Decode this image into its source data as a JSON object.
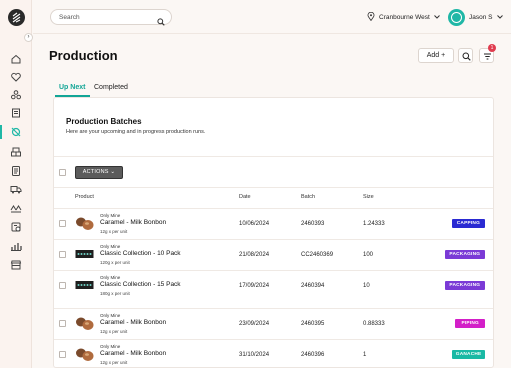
{
  "search": {
    "placeholder": "Search"
  },
  "location": {
    "label": "Cranbourne West"
  },
  "user": {
    "name": "Jason S"
  },
  "header": {
    "title": "Production",
    "add_label": "Add +",
    "notification_count": "1"
  },
  "tabs": [
    {
      "label": "Up Next"
    },
    {
      "label": "Completed"
    }
  ],
  "card": {
    "title": "Production Batches",
    "subtitle": "Here are your upcoming and in progress production runs.",
    "actions_label": "ACTIONS ⌄"
  },
  "table": {
    "columns": {
      "product": "Product",
      "date": "Date",
      "batch": "Batch",
      "size": "Size"
    },
    "rows": [
      {
        "brand": "Only Mine",
        "name": "Caramel - Milk Bonbon",
        "weight": "12g x per unit",
        "date": "10/06/2024",
        "batch": "2460393",
        "size": "1.24333",
        "status": "CAPPING",
        "status_color": "#2a2ad2",
        "thumb": "bonbon"
      },
      {
        "brand": "Only Mine",
        "name": "Classic Collection - 10 Pack",
        "weight": "120g x per unit",
        "date": "21/08/2024",
        "batch": "CC2460369",
        "size": "100",
        "status": "PACKAGING",
        "status_color": "#7b3ad6",
        "thumb": "box"
      },
      {
        "brand": "Only Mine",
        "name": "Classic Collection - 15 Pack",
        "weight": "180g x per unit",
        "date": "17/09/2024",
        "batch": "2460394",
        "size": "10",
        "status": "PACKAGING",
        "status_color": "#7b3ad6",
        "thumb": "box"
      },
      {
        "brand": "Only Mine",
        "name": "Caramel - Milk Bonbon",
        "weight": "12g x per unit",
        "date": "23/09/2024",
        "batch": "2460395",
        "size": "0.88333",
        "status": "PIPING",
        "status_color": "#d31fc8",
        "thumb": "bonbon"
      },
      {
        "brand": "Only Mine",
        "name": "Caramel - Milk Bonbon",
        "weight": "12g x per unit",
        "date": "31/10/2024",
        "batch": "2460396",
        "size": "1",
        "status": "GANACHE",
        "status_color": "#19b9a4",
        "thumb": "bonbon"
      }
    ]
  },
  "sidebar": {
    "items": [
      {
        "icon": "home-icon"
      },
      {
        "icon": "heart-icon"
      },
      {
        "icon": "ingredients-icon"
      },
      {
        "icon": "recipe-icon"
      },
      {
        "icon": "production-icon",
        "active": true
      },
      {
        "icon": "inventory-icon"
      },
      {
        "icon": "orders-icon"
      },
      {
        "icon": "delivery-icon"
      },
      {
        "icon": "team-icon"
      },
      {
        "icon": "billing-icon"
      },
      {
        "icon": "reports-icon"
      },
      {
        "icon": "store-icon"
      }
    ]
  }
}
